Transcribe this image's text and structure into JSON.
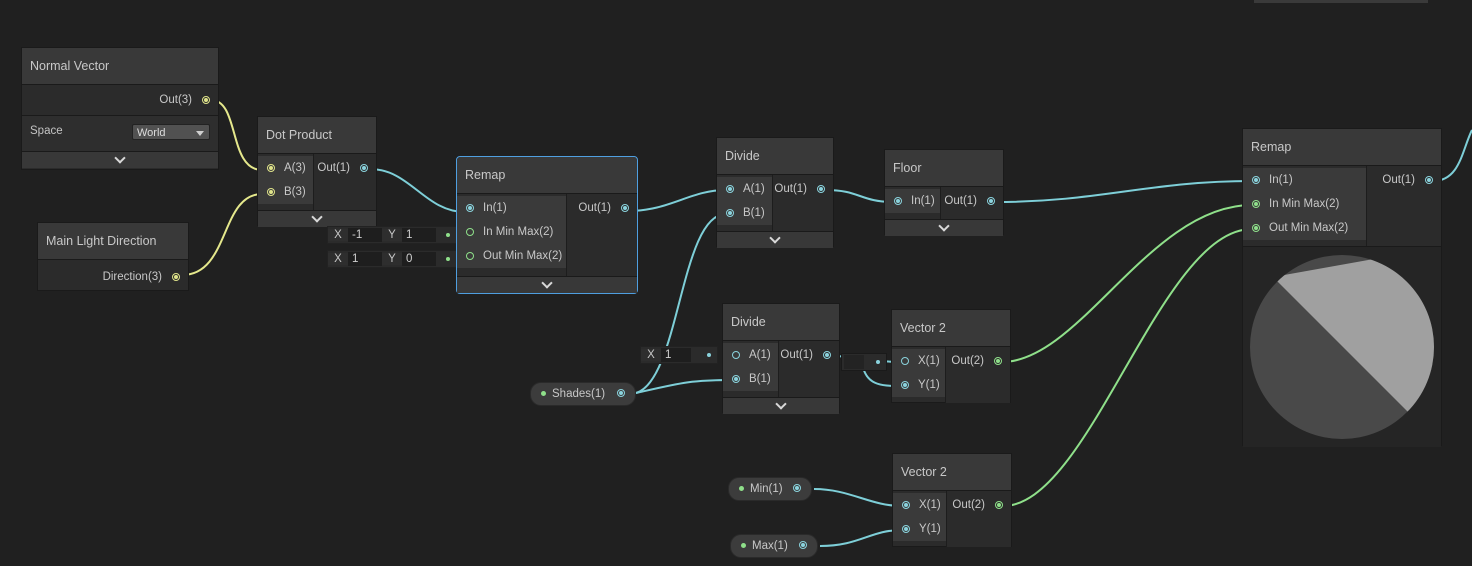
{
  "colors": {
    "background": "#202020",
    "wire_vec1": "#7ecfd8",
    "wire_vec2": "#8fe08a",
    "wire_vec3": "#e5e88c",
    "selection": "#4f9fe0"
  },
  "nodes": {
    "normal_vector": {
      "title": "Normal Vector",
      "out": "Out(3)",
      "space_label": "Space",
      "space_value": "World"
    },
    "dot_product": {
      "title": "Dot Product",
      "in_a": "A(3)",
      "in_b": "B(3)",
      "out": "Out(1)"
    },
    "main_light": {
      "title": "Main Light Direction",
      "out": "Direction(3)"
    },
    "remap1": {
      "title": "Remap",
      "in": "In(1)",
      "in_minmax": "In Min Max(2)",
      "out_minmax": "Out Min Max(2)",
      "out": "Out(1)",
      "in_minmax_x_label": "X",
      "in_minmax_x": "-1",
      "in_minmax_y_label": "Y",
      "in_minmax_y": "1",
      "out_minmax_x_label": "X",
      "out_minmax_x": "1",
      "out_minmax_y_label": "Y",
      "out_minmax_y": "0"
    },
    "divide1": {
      "title": "Divide",
      "in_a": "A(1)",
      "in_b": "B(1)",
      "out": "Out(1)"
    },
    "floor": {
      "title": "Floor",
      "in": "In(1)",
      "out": "Out(1)"
    },
    "divide2": {
      "title": "Divide",
      "in_a": "A(1)",
      "in_b": "B(1)",
      "out": "Out(1)",
      "a_x_label": "X",
      "a_x": "1"
    },
    "vector2_a": {
      "title": "Vector 2",
      "in_x": "X(1)",
      "in_y": "Y(1)",
      "out": "Out(2)"
    },
    "vector2_b": {
      "title": "Vector 2",
      "in_x": "X(1)",
      "in_y": "Y(1)",
      "out": "Out(2)"
    },
    "remap2": {
      "title": "Remap",
      "in": "In(1)",
      "in_minmax": "In Min Max(2)",
      "out_minmax": "Out Min Max(2)",
      "out": "Out(1)"
    }
  },
  "properties": {
    "shades": "Shades(1)",
    "min": "Min(1)",
    "max": "Max(1)"
  }
}
